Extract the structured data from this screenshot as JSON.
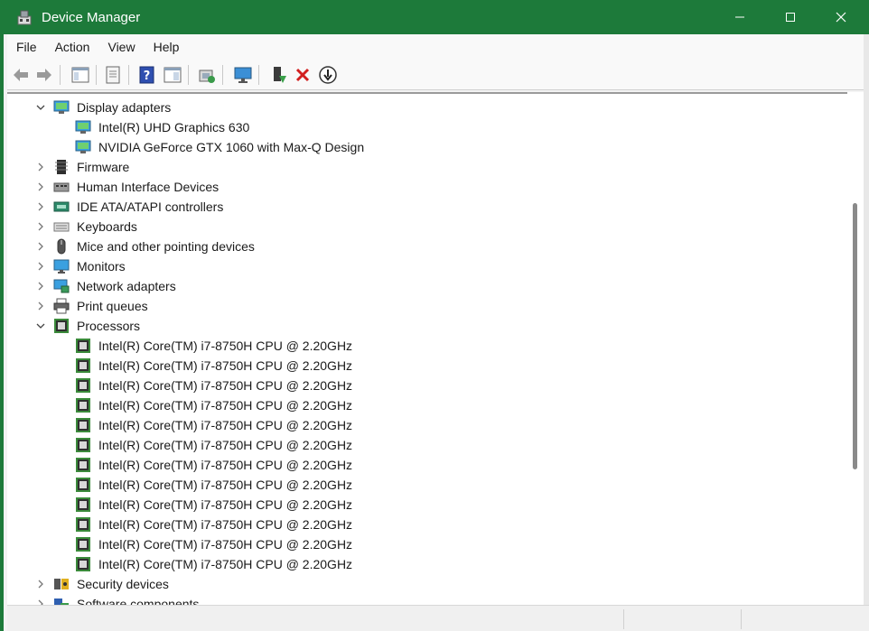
{
  "window": {
    "title": "Device Manager"
  },
  "menu": [
    "File",
    "Action",
    "View",
    "Help"
  ],
  "toolbar": [
    {
      "name": "back-icon"
    },
    {
      "name": "forward-icon"
    },
    {
      "name": "show-hide-console-tree-icon"
    },
    {
      "name": "properties-icon"
    },
    {
      "name": "help-icon"
    },
    {
      "name": "action-pane-icon"
    },
    {
      "name": "scan-hardware-icon"
    },
    {
      "name": "monitor-icon"
    },
    {
      "name": "update-driver-icon"
    },
    {
      "name": "uninstall-device-icon"
    },
    {
      "name": "disable-device-icon"
    }
  ],
  "tree": [
    {
      "label": "Display adapters",
      "level": 0,
      "expanded": true,
      "icon": "display-adapter-icon"
    },
    {
      "label": "Intel(R) UHD Graphics 630",
      "level": 1,
      "icon": "display-adapter-icon"
    },
    {
      "label": "NVIDIA GeForce GTX 1060 with Max-Q Design",
      "level": 1,
      "icon": "display-adapter-icon"
    },
    {
      "label": "Firmware",
      "level": 0,
      "expanded": false,
      "icon": "firmware-icon"
    },
    {
      "label": "Human Interface Devices",
      "level": 0,
      "expanded": false,
      "icon": "hid-icon"
    },
    {
      "label": "IDE ATA/ATAPI controllers",
      "level": 0,
      "expanded": false,
      "icon": "ide-controller-icon"
    },
    {
      "label": "Keyboards",
      "level": 0,
      "expanded": false,
      "icon": "keyboard-icon"
    },
    {
      "label": "Mice and other pointing devices",
      "level": 0,
      "expanded": false,
      "icon": "mouse-icon"
    },
    {
      "label": "Monitors",
      "level": 0,
      "expanded": false,
      "icon": "monitor-icon"
    },
    {
      "label": "Network adapters",
      "level": 0,
      "expanded": false,
      "icon": "network-adapter-icon"
    },
    {
      "label": "Print queues",
      "level": 0,
      "expanded": false,
      "icon": "printer-icon"
    },
    {
      "label": "Processors",
      "level": 0,
      "expanded": true,
      "icon": "processor-icon"
    },
    {
      "label": "Intel(R) Core(TM) i7-8750H CPU @ 2.20GHz",
      "level": 1,
      "icon": "processor-icon"
    },
    {
      "label": "Intel(R) Core(TM) i7-8750H CPU @ 2.20GHz",
      "level": 1,
      "icon": "processor-icon"
    },
    {
      "label": "Intel(R) Core(TM) i7-8750H CPU @ 2.20GHz",
      "level": 1,
      "icon": "processor-icon"
    },
    {
      "label": "Intel(R) Core(TM) i7-8750H CPU @ 2.20GHz",
      "level": 1,
      "icon": "processor-icon"
    },
    {
      "label": "Intel(R) Core(TM) i7-8750H CPU @ 2.20GHz",
      "level": 1,
      "icon": "processor-icon"
    },
    {
      "label": "Intel(R) Core(TM) i7-8750H CPU @ 2.20GHz",
      "level": 1,
      "icon": "processor-icon"
    },
    {
      "label": "Intel(R) Core(TM) i7-8750H CPU @ 2.20GHz",
      "level": 1,
      "icon": "processor-icon"
    },
    {
      "label": "Intel(R) Core(TM) i7-8750H CPU @ 2.20GHz",
      "level": 1,
      "icon": "processor-icon"
    },
    {
      "label": "Intel(R) Core(TM) i7-8750H CPU @ 2.20GHz",
      "level": 1,
      "icon": "processor-icon"
    },
    {
      "label": "Intel(R) Core(TM) i7-8750H CPU @ 2.20GHz",
      "level": 1,
      "icon": "processor-icon"
    },
    {
      "label": "Intel(R) Core(TM) i7-8750H CPU @ 2.20GHz",
      "level": 1,
      "icon": "processor-icon"
    },
    {
      "label": "Intel(R) Core(TM) i7-8750H CPU @ 2.20GHz",
      "level": 1,
      "icon": "processor-icon"
    },
    {
      "label": "Security devices",
      "level": 0,
      "expanded": false,
      "icon": "security-device-icon"
    },
    {
      "label": "Software components",
      "level": 0,
      "expanded": false,
      "icon": "software-component-icon"
    }
  ],
  "scroll": {
    "position": 0.45,
    "visible_fraction": 0.52
  },
  "colors": {
    "titlebar": "#1d7a3a",
    "accent": "#1d7a3a"
  }
}
